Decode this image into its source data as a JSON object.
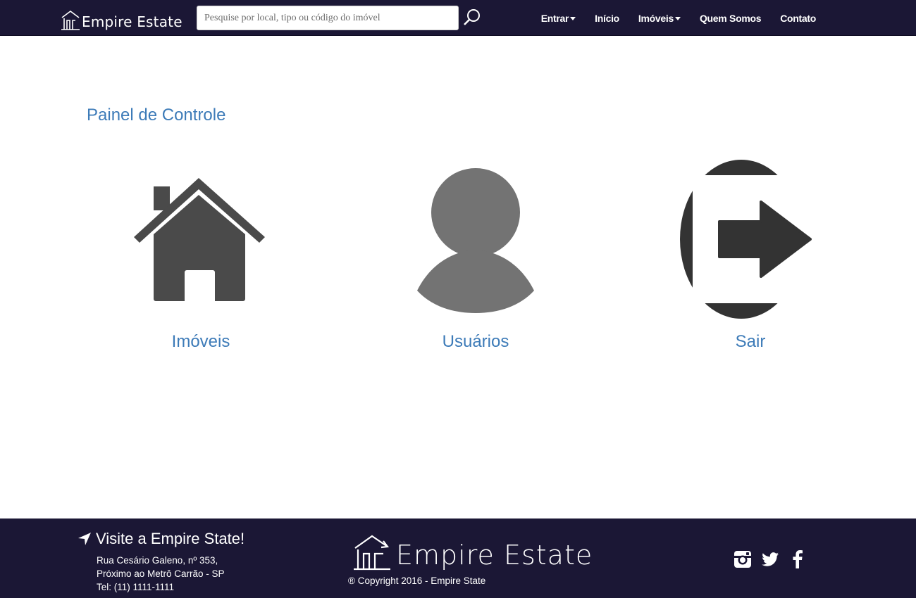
{
  "navbar": {
    "brand": "Empire Estate",
    "brand_icon": "house-logo-icon",
    "search_placeholder": "Pesquise por local, tipo ou código do imóvel",
    "search_icon": "magnifier-icon",
    "links": [
      {
        "label": "Entrar",
        "dropdown": true
      },
      {
        "label": "Início",
        "dropdown": false
      },
      {
        "label": "Imóveis",
        "dropdown": true
      },
      {
        "label": "Quem Somos",
        "dropdown": false
      },
      {
        "label": "Contato",
        "dropdown": false
      }
    ]
  },
  "main": {
    "title": "Painel de Controle",
    "tiles": [
      {
        "label": "Imóveis",
        "icon": "home-icon"
      },
      {
        "label": "Usuários",
        "icon": "user-icon"
      },
      {
        "label": "Sair",
        "icon": "sign-out-icon"
      }
    ]
  },
  "footer": {
    "visit_title": "Visite a Empire State!",
    "visit_icon": "location-arrow-icon",
    "address_line1": "Rua Cesário Galeno, nº 353,",
    "address_line2": "Próximo ao Metrô Carrão - SP",
    "phone": "Tel: (11) 1111-1111",
    "brand": "Empire Estate",
    "copyright": "® Copyright 2016 - Empire State",
    "social": [
      "instagram-icon",
      "twitter-icon",
      "facebook-icon"
    ]
  },
  "colors": {
    "navbar_bg": "#1b1735",
    "accent": "#3d7bb8",
    "icon_dark": "#4a4a4a",
    "icon_gray": "#737373"
  }
}
